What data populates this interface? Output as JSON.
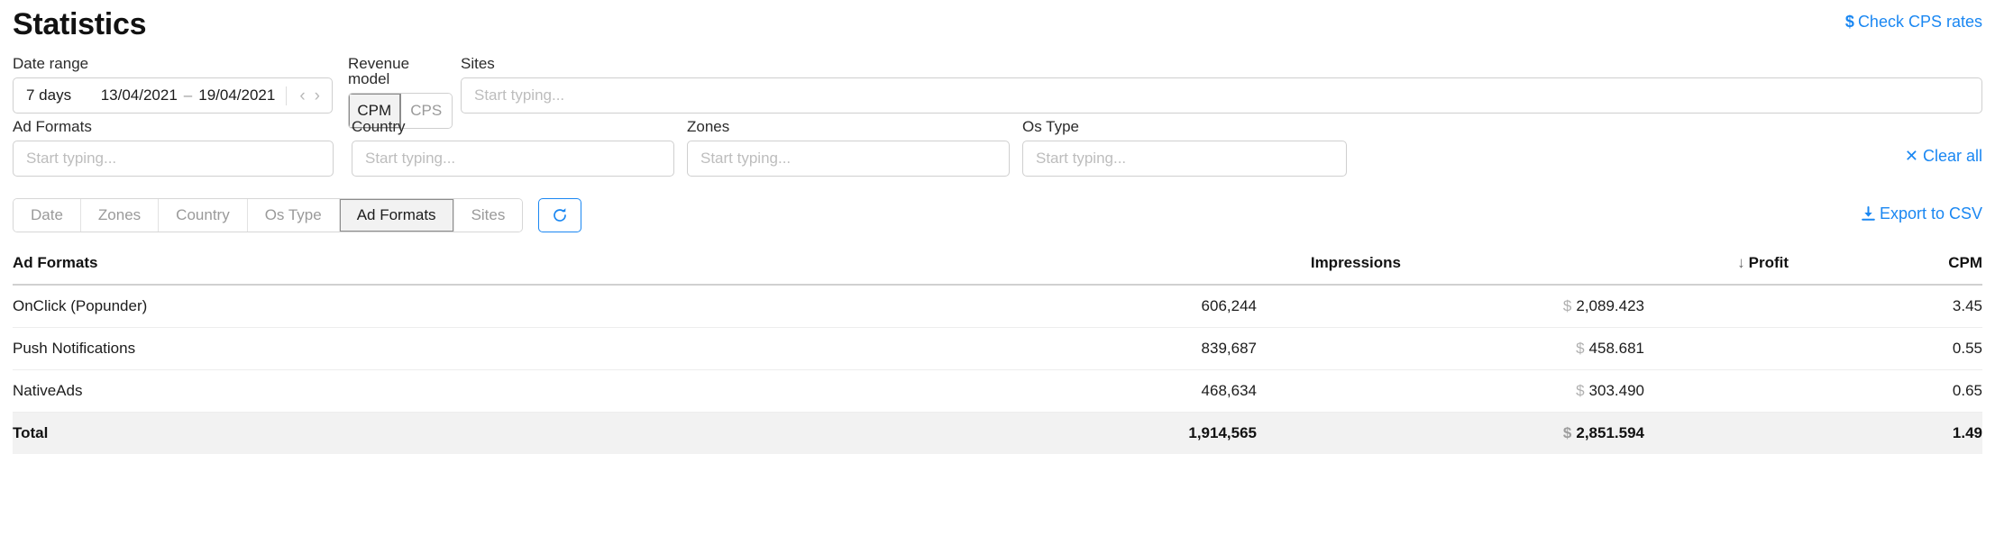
{
  "header": {
    "title": "Statistics",
    "cps_link": "Check CPS rates",
    "cps_icon": "dollar-icon",
    "cps_icon_glyph": "$"
  },
  "filters": {
    "date_range": {
      "label": "Date range",
      "preset": "7 days",
      "start": "13/04/2021",
      "dash": "–",
      "end": "19/04/2021",
      "prev_icon": "chevron-left-icon",
      "prev_glyph": "‹",
      "next_icon": "chevron-right-icon",
      "next_glyph": "›"
    },
    "revenue_model": {
      "label": "Revenue model",
      "options": [
        "CPM",
        "CPS"
      ],
      "selected": "CPM"
    },
    "sites": {
      "label": "Sites",
      "value": "",
      "placeholder": "Start typing..."
    },
    "ad_formats": {
      "label": "Ad Formats",
      "value": "",
      "placeholder": "Start typing..."
    },
    "country": {
      "label": "Country",
      "value": "",
      "placeholder": "Start typing..."
    },
    "zones": {
      "label": "Zones",
      "value": "",
      "placeholder": "Start typing..."
    },
    "os_type": {
      "label": "Os Type",
      "value": "",
      "placeholder": "Start typing..."
    },
    "clear_all": {
      "label": "Clear all",
      "icon": "close-x-icon",
      "icon_glyph": "✕"
    }
  },
  "groupby_tabs": {
    "items": [
      {
        "label": "Date",
        "active": false
      },
      {
        "label": "Zones",
        "active": false
      },
      {
        "label": "Country",
        "active": false
      },
      {
        "label": "Os Type",
        "active": false
      },
      {
        "label": "Ad Formats",
        "active": true
      },
      {
        "label": "Sites",
        "active": false
      }
    ],
    "refresh_icon": "refresh-icon",
    "export": {
      "label": "Export to CSV",
      "icon": "download-icon"
    }
  },
  "table": {
    "columns": [
      {
        "key": "name",
        "label": "Ad Formats",
        "align": "left"
      },
      {
        "key": "impressions",
        "label": "Impressions",
        "align": "right"
      },
      {
        "key": "profit",
        "label": "Profit",
        "align": "right",
        "sorted": "desc",
        "sort_glyph": "↓"
      },
      {
        "key": "cpm",
        "label": "CPM",
        "align": "right"
      }
    ],
    "currency_symbol": "$",
    "rows": [
      {
        "name": "OnClick (Popunder)",
        "impressions": "606,244",
        "profit": "2,089.423",
        "cpm": "3.45"
      },
      {
        "name": "Push Notifications",
        "impressions": "839,687",
        "profit": "458.681",
        "cpm": "0.55"
      },
      {
        "name": "NativeAds",
        "impressions": "468,634",
        "profit": "303.490",
        "cpm": "0.65"
      }
    ],
    "total": {
      "name": "Total",
      "impressions": "1,914,565",
      "profit": "2,851.594",
      "cpm": "1.49"
    }
  },
  "colors": {
    "link_blue": "#1a87f2",
    "total_row_bg": "#f2f2f2",
    "active_tab_bg": "#f2f2f2",
    "border_grey": "#cfcfcf"
  }
}
